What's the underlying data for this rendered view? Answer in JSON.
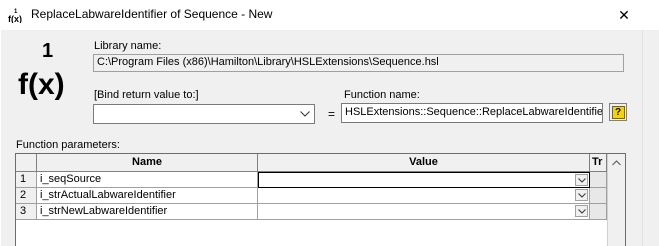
{
  "window": {
    "title": "ReplaceLabwareIdentifier of Sequence - New",
    "icon": "fx-icon",
    "close_glyph": "✕"
  },
  "logo": {
    "superscript": "1",
    "text": "f(x)"
  },
  "library": {
    "label": "Library name:",
    "value": "C:\\Program Files (x86)\\Hamilton\\Library\\HSLExtensions\\Sequence.hsl"
  },
  "return_binding": {
    "label": "[Bind return value to:]",
    "value": ""
  },
  "equals": "=",
  "function_name": {
    "label": "Function name:",
    "value": "HSLExtensions::Sequence::ReplaceLabwareIdentifier"
  },
  "help_button": {
    "glyph": "?"
  },
  "parameters": {
    "label": "Function parameters:",
    "columns": {
      "name": "Name",
      "value": "Value",
      "tr": "Tr"
    },
    "rows": [
      {
        "index": "1",
        "name": "i_seqSource",
        "value": ""
      },
      {
        "index": "2",
        "name": "i_strActualLabwareIdentifier",
        "value": ""
      },
      {
        "index": "3",
        "name": "i_strNewLabwareIdentifier",
        "value": ""
      }
    ]
  },
  "colors": {
    "dialog_bg": "#f0f0f0",
    "titlebar_bg": "#ffffff",
    "help_icon_bg": "#f5d400"
  }
}
